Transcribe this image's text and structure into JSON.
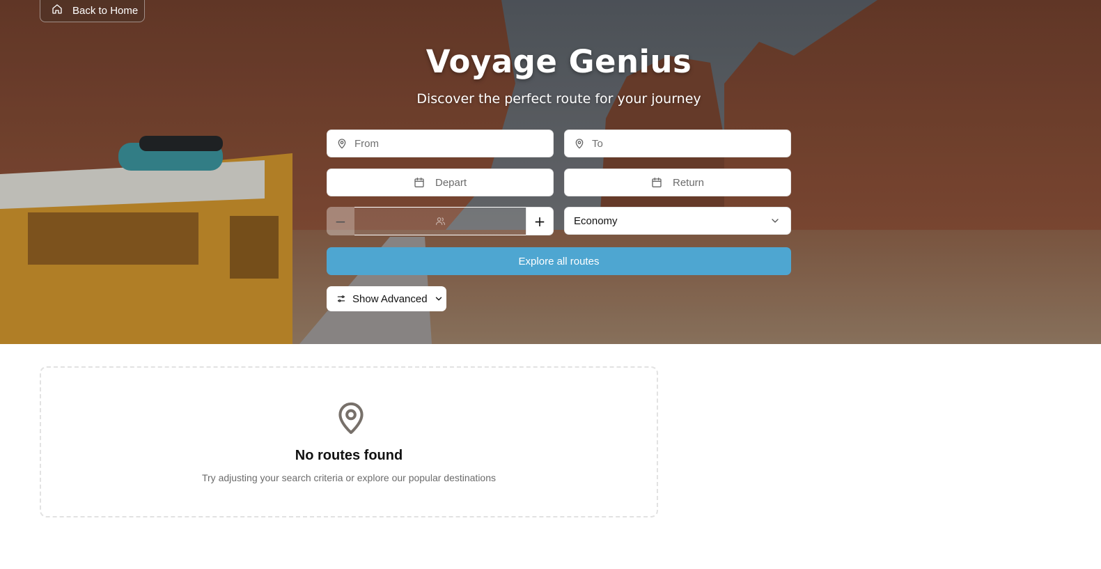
{
  "nav": {
    "back_label": "Back to Home"
  },
  "hero": {
    "title": "Voyage Genius",
    "subtitle": "Discover the perfect route for your journey"
  },
  "search": {
    "from_placeholder": "From",
    "to_placeholder": "To",
    "depart_label": "Depart",
    "return_label": "Return",
    "travelers": {
      "minus": "−",
      "plus": "+"
    },
    "cabin_class": "Economy",
    "explore_label": "Explore all routes",
    "advanced_label": "Show Advanced"
  },
  "results": {
    "empty_title": "No routes found",
    "empty_message": "Try adjusting your search criteria or explore our popular destinations"
  },
  "colors": {
    "primary_button": "#4ea6d1",
    "empty_icon": "#77706a"
  }
}
